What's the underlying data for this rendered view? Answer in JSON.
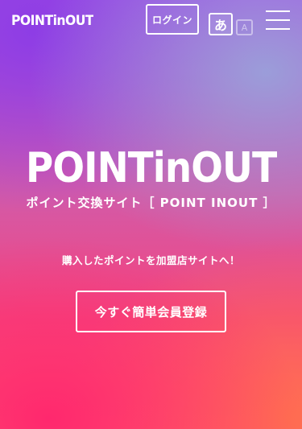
{
  "header": {
    "logo_text": "POINT INOUT",
    "login_label": "ログイン",
    "lang_ja_label": "あ",
    "lang_en_label": "A"
  },
  "hero": {
    "logo_text": "POINT INOUT",
    "tagline": "ポイント交換サイト［ POINT INOUT ］",
    "subtext": "購入したポイントを加盟店サイトへ！",
    "register_label": "今すぐ簡単会員登録"
  },
  "icons": {
    "menu": "hamburger-menu-icon"
  }
}
